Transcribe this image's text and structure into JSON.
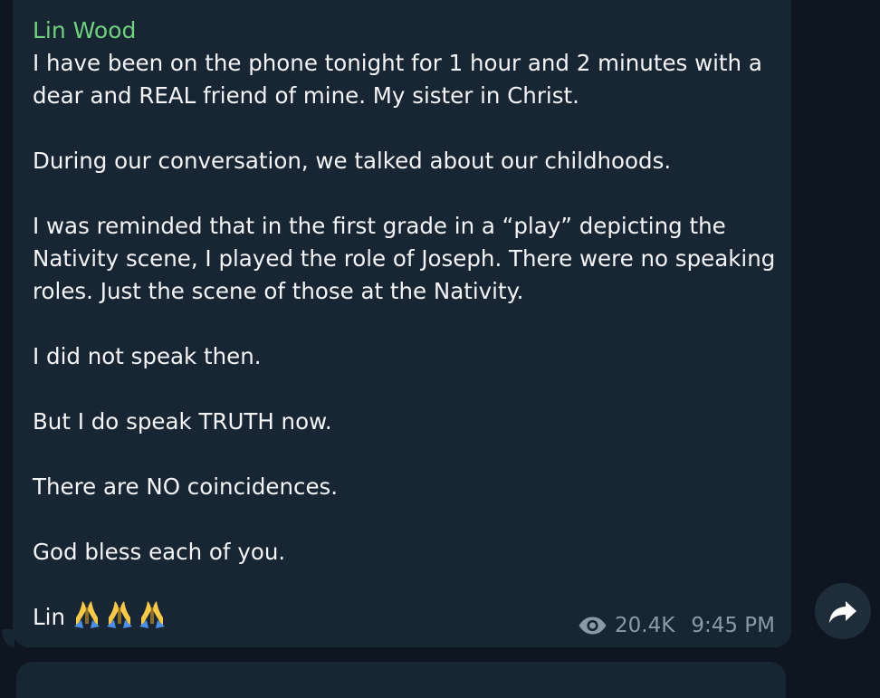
{
  "message": {
    "sender_name": "Lin Wood",
    "paragraphs": [
      [
        "I have been on the phone tonight for 1 hour and 2 minutes with a",
        "dear and REAL friend of mine. My sister in Christ."
      ],
      [
        "During our conversation, we talked about our childhoods."
      ],
      [
        "I was reminded that in the first grade in a “play” depicting the",
        "Nativity scene, I played the role of Joseph. There were no speaking",
        "roles. Just the scene of those at the Nativity."
      ],
      [
        "I did not speak then."
      ],
      [
        "But I do speak TRUTH now."
      ],
      [
        "There are NO coincidences."
      ],
      [
        "God bless each of you."
      ]
    ],
    "signature": "Lin",
    "signature_icons": [
      "folded-hands-icon",
      "folded-hands-icon",
      "folded-hands-icon"
    ],
    "views": "20.4K",
    "time": "9:45 PM",
    "view_icon": "eye-icon"
  },
  "actions": {
    "forward_icon": "forward-arrow-icon"
  },
  "colors": {
    "background": "#0e1621",
    "bubble": "#182533",
    "sender": "#6fd07d",
    "text": "#f3f5f7",
    "meta": "#8a9aa7",
    "forward_button": "#1f2d3a"
  }
}
